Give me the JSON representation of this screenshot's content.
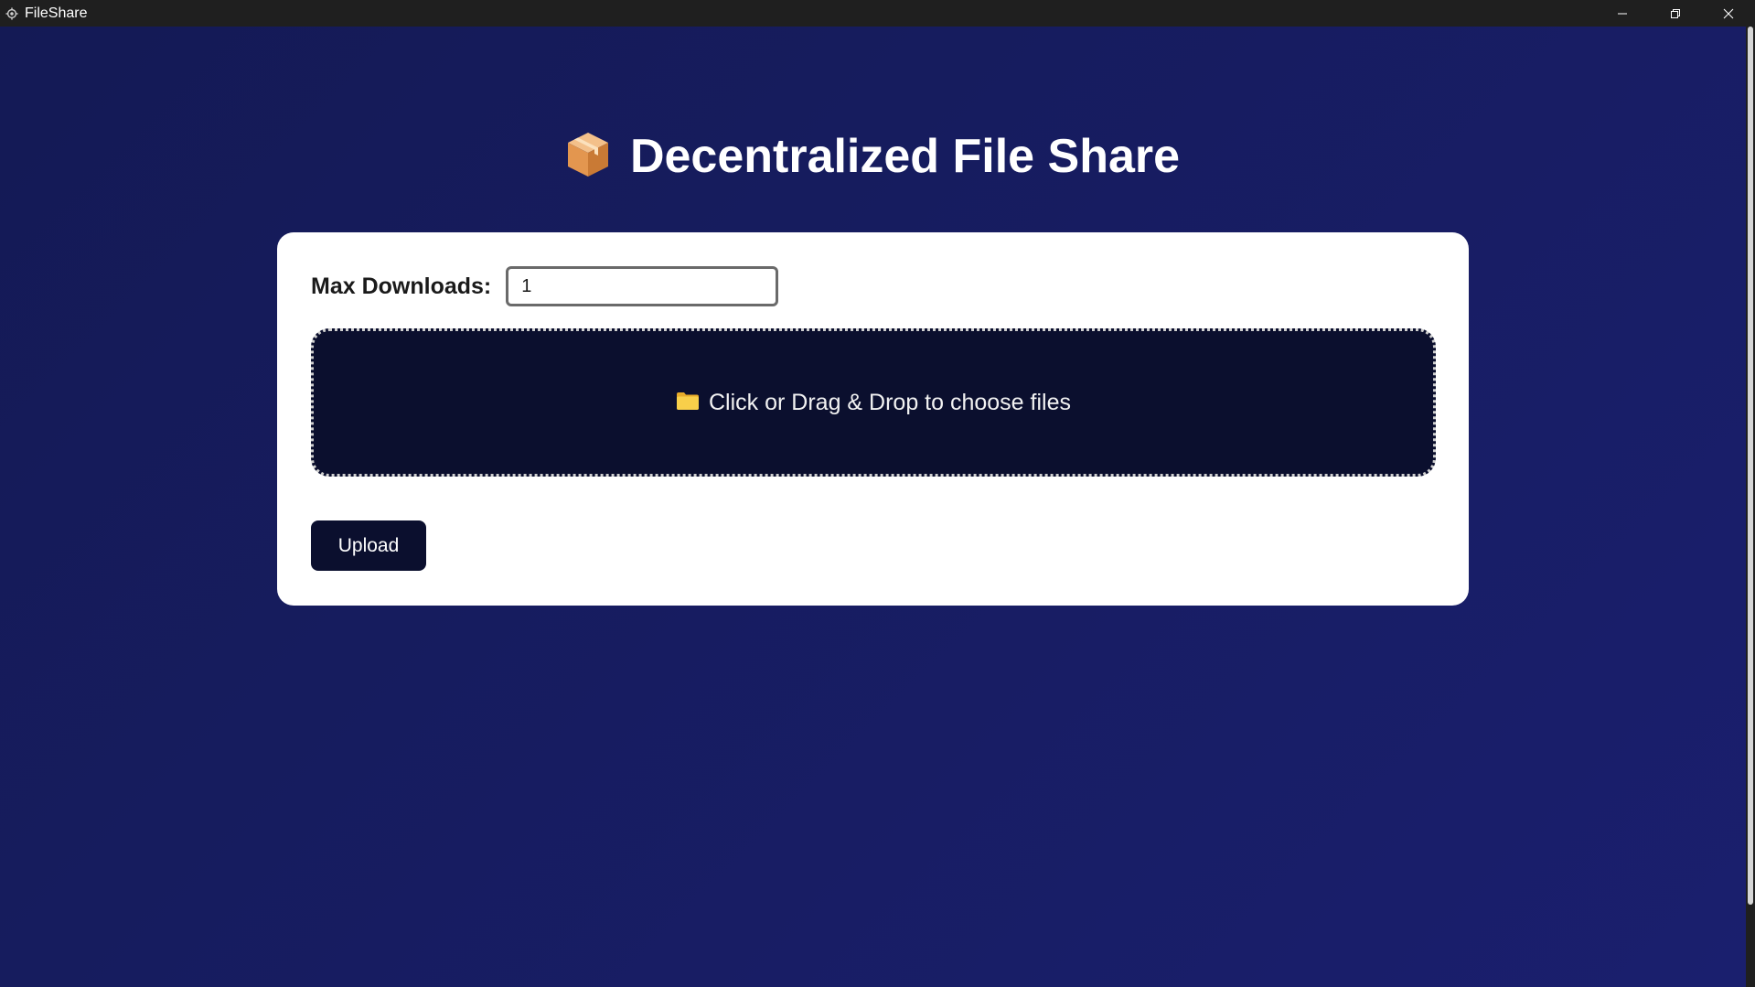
{
  "window": {
    "title": "FileShare",
    "icon": "gear-icon",
    "controls": [
      "minimize-icon",
      "restore-icon",
      "close-icon"
    ]
  },
  "header": {
    "icon": "package-icon",
    "title": "Decentralized File Share"
  },
  "form": {
    "max_downloads_label": "Max Downloads:",
    "max_downloads_value": "1",
    "dropzone_icon": "folder-icon",
    "dropzone_text": "Click or Drag & Drop to choose files",
    "upload_label": "Upload"
  },
  "colors": {
    "background": "#161c62",
    "card": "#ffffff",
    "dark_accent": "#0b0f2e",
    "folder": "#f5c84a",
    "package": "#e8a25a"
  }
}
